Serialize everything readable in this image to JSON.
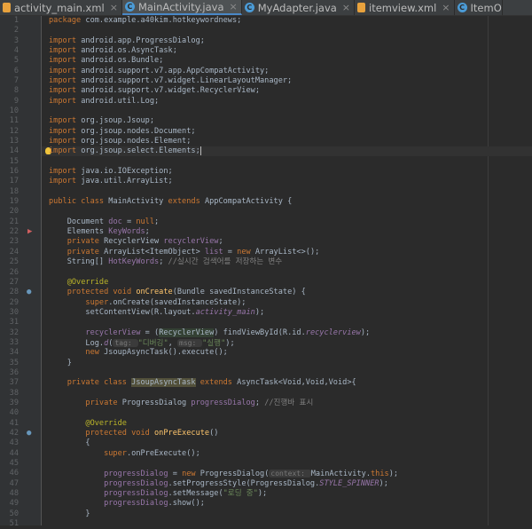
{
  "tabs": [
    {
      "label": "activity_main.xml",
      "type": "xml",
      "active": false
    },
    {
      "label": "MainActivity.java",
      "type": "java",
      "active": true
    },
    {
      "label": "MyAdapter.java",
      "type": "java",
      "active": false
    },
    {
      "label": "itemview.xml",
      "type": "xml",
      "active": false
    },
    {
      "label": "ItemO",
      "type": "java",
      "active": false
    }
  ],
  "caret_line": 14,
  "gutter_markers": [
    {
      "line": 22,
      "kind": "run"
    },
    {
      "line": 28,
      "kind": "override"
    },
    {
      "line": 42,
      "kind": "override"
    }
  ],
  "lines": [
    {
      "n": 1,
      "t": [
        [
          "k",
          "package "
        ],
        [
          "",
          "com.example.a40kim.hotkeywordnews;"
        ]
      ]
    },
    {
      "n": 2,
      "t": []
    },
    {
      "n": 3,
      "t": [
        [
          "k",
          "import "
        ],
        [
          "",
          "android.app.ProgressDialog;"
        ]
      ]
    },
    {
      "n": 4,
      "t": [
        [
          "k",
          "import "
        ],
        [
          "",
          "android.os.AsyncTask;"
        ]
      ]
    },
    {
      "n": 5,
      "t": [
        [
          "k",
          "import "
        ],
        [
          "",
          "android.os.Bundle;"
        ]
      ]
    },
    {
      "n": 6,
      "t": [
        [
          "k",
          "import "
        ],
        [
          "",
          "android.support.v7.app.AppCompatActivity;"
        ]
      ]
    },
    {
      "n": 7,
      "t": [
        [
          "k",
          "import "
        ],
        [
          "",
          "android.support.v7.widget.LinearLayoutManager;"
        ]
      ]
    },
    {
      "n": 8,
      "t": [
        [
          "k",
          "import "
        ],
        [
          "",
          "android.support.v7.widget.RecyclerView;"
        ]
      ]
    },
    {
      "n": 9,
      "t": [
        [
          "k",
          "import "
        ],
        [
          "",
          "android.util.Log;"
        ]
      ]
    },
    {
      "n": 10,
      "t": []
    },
    {
      "n": 11,
      "t": [
        [
          "k",
          "import "
        ],
        [
          "",
          "org.jsoup.Jsoup;"
        ]
      ]
    },
    {
      "n": 12,
      "t": [
        [
          "k",
          "import "
        ],
        [
          "",
          "org.jsoup.nodes.Document;"
        ]
      ]
    },
    {
      "n": 13,
      "t": [
        [
          "k",
          "import "
        ],
        [
          "",
          "org.jsoup.nodes.Element;"
        ]
      ]
    },
    {
      "n": 14,
      "t": [
        [
          "k",
          "import "
        ],
        [
          "",
          "org.jsoup.select.Elements;"
        ]
      ]
    },
    {
      "n": 15,
      "t": []
    },
    {
      "n": 16,
      "t": [
        [
          "k",
          "import "
        ],
        [
          "",
          "java.io.IOException;"
        ]
      ]
    },
    {
      "n": 17,
      "t": [
        [
          "k",
          "import "
        ],
        [
          "",
          "java.util.ArrayList;"
        ]
      ]
    },
    {
      "n": 18,
      "t": []
    },
    {
      "n": 19,
      "t": [
        [
          "k",
          "public class "
        ],
        [
          "",
          "MainActivity "
        ],
        [
          "k",
          "extends "
        ],
        [
          "",
          "AppCompatActivity {"
        ]
      ]
    },
    {
      "n": 20,
      "t": []
    },
    {
      "n": 21,
      "t": [
        [
          "",
          "    Document "
        ],
        [
          "fd",
          "doc"
        ],
        [
          "",
          " = "
        ],
        [
          "k",
          "null"
        ],
        [
          "",
          ";"
        ]
      ]
    },
    {
      "n": 22,
      "t": [
        [
          "",
          "    Elements "
        ],
        [
          "fd",
          "KeyWords"
        ],
        [
          "",
          ";"
        ]
      ]
    },
    {
      "n": 23,
      "t": [
        [
          "k",
          "    private "
        ],
        [
          "",
          "RecyclerView "
        ],
        [
          "fd",
          "recyclerView"
        ],
        [
          "",
          ";"
        ]
      ]
    },
    {
      "n": 24,
      "t": [
        [
          "k",
          "    private "
        ],
        [
          "",
          "ArrayList<ItemObject> "
        ],
        [
          "fd",
          "list"
        ],
        [
          "",
          " = "
        ],
        [
          "k",
          "new "
        ],
        [
          "",
          "ArrayList<>();"
        ]
      ]
    },
    {
      "n": 25,
      "t": [
        [
          "",
          "    String[] "
        ],
        [
          "fd",
          "HotKeyWords"
        ],
        [
          "",
          "; "
        ],
        [
          "cm",
          "//실시간 검색어를 저장하는 변수"
        ]
      ]
    },
    {
      "n": 26,
      "t": []
    },
    {
      "n": 27,
      "t": [
        [
          "an",
          "    @Override"
        ]
      ]
    },
    {
      "n": 28,
      "t": [
        [
          "k",
          "    protected void "
        ],
        [
          "fn",
          "onCreate"
        ],
        [
          "",
          "(Bundle savedInstanceState) {"
        ]
      ]
    },
    {
      "n": 29,
      "t": [
        [
          "k",
          "        super"
        ],
        [
          "",
          ".onCreate(savedInstanceState);"
        ]
      ]
    },
    {
      "n": 30,
      "t": [
        [
          "",
          "        setContentView(R.layout."
        ],
        [
          "fdi",
          "activity_main"
        ],
        [
          "",
          ");"
        ]
      ]
    },
    {
      "n": 31,
      "t": []
    },
    {
      "n": 32,
      "t": [
        [
          "fd",
          "        recyclerView"
        ],
        [
          "",
          " = ("
        ],
        [
          "hl",
          "RecyclerView"
        ],
        [
          "",
          ") findViewById(R.id."
        ],
        [
          "fdi",
          "recyclerview"
        ],
        [
          "",
          ");"
        ]
      ]
    },
    {
      "n": 33,
      "t": [
        [
          "",
          "        Log."
        ],
        [
          "ci",
          "d"
        ],
        [
          "",
          "("
        ],
        [
          "hint",
          "tag: "
        ],
        [
          "s",
          "\"디버깅\""
        ],
        [
          "",
          ", "
        ],
        [
          "hint",
          "msg: "
        ],
        [
          "s",
          "\"실행\""
        ],
        [
          "",
          ");"
        ]
      ]
    },
    {
      "n": 34,
      "t": [
        [
          "k",
          "        new "
        ],
        [
          "",
          "JsoupAsyncTask().execute();"
        ]
      ]
    },
    {
      "n": 35,
      "t": [
        [
          "",
          "    }"
        ]
      ]
    },
    {
      "n": 36,
      "t": []
    },
    {
      "n": 37,
      "t": [
        [
          "k",
          "    private class "
        ],
        [
          "hl2",
          "JsoupAsyncTask"
        ],
        [
          "k",
          " extends "
        ],
        [
          "",
          "AsyncTask<Void,Void,Void>{"
        ]
      ]
    },
    {
      "n": 38,
      "t": []
    },
    {
      "n": 39,
      "t": [
        [
          "k",
          "        private "
        ],
        [
          "",
          "ProgressDialog "
        ],
        [
          "fd",
          "progressDialog"
        ],
        [
          "",
          "; "
        ],
        [
          "cm",
          "//진행바 표시"
        ]
      ]
    },
    {
      "n": 40,
      "t": []
    },
    {
      "n": 41,
      "t": [
        [
          "an",
          "        @Override"
        ]
      ]
    },
    {
      "n": 42,
      "t": [
        [
          "k",
          "        protected void "
        ],
        [
          "fn",
          "onPreExecute"
        ],
        [
          "",
          "()"
        ]
      ]
    },
    {
      "n": 43,
      "t": [
        [
          "",
          "        {"
        ]
      ]
    },
    {
      "n": 44,
      "t": [
        [
          "k",
          "            super"
        ],
        [
          "",
          ".onPreExecute();"
        ]
      ]
    },
    {
      "n": 45,
      "t": []
    },
    {
      "n": 46,
      "t": [
        [
          "fd",
          "            progressDialog"
        ],
        [
          "",
          " = "
        ],
        [
          "k",
          "new "
        ],
        [
          "",
          "ProgressDialog("
        ],
        [
          "hint",
          "context: "
        ],
        [
          "",
          "MainActivity."
        ],
        [
          "k",
          "this"
        ],
        [
          "",
          ");"
        ]
      ]
    },
    {
      "n": 47,
      "t": [
        [
          "fd",
          "            progressDialog"
        ],
        [
          "",
          ".setProgressStyle(ProgressDialog."
        ],
        [
          "fdi",
          "STYLE_SPINNER"
        ],
        [
          "",
          ");"
        ]
      ]
    },
    {
      "n": 48,
      "t": [
        [
          "fd",
          "            progressDialog"
        ],
        [
          "",
          ".setMessage("
        ],
        [
          "s",
          "\"로딩 중\""
        ],
        [
          "",
          ");"
        ]
      ]
    },
    {
      "n": 49,
      "t": [
        [
          "fd",
          "            progressDialog"
        ],
        [
          "",
          ".show();"
        ]
      ]
    },
    {
      "n": 50,
      "t": [
        [
          "",
          "        }"
        ]
      ]
    },
    {
      "n": 51,
      "t": []
    }
  ]
}
